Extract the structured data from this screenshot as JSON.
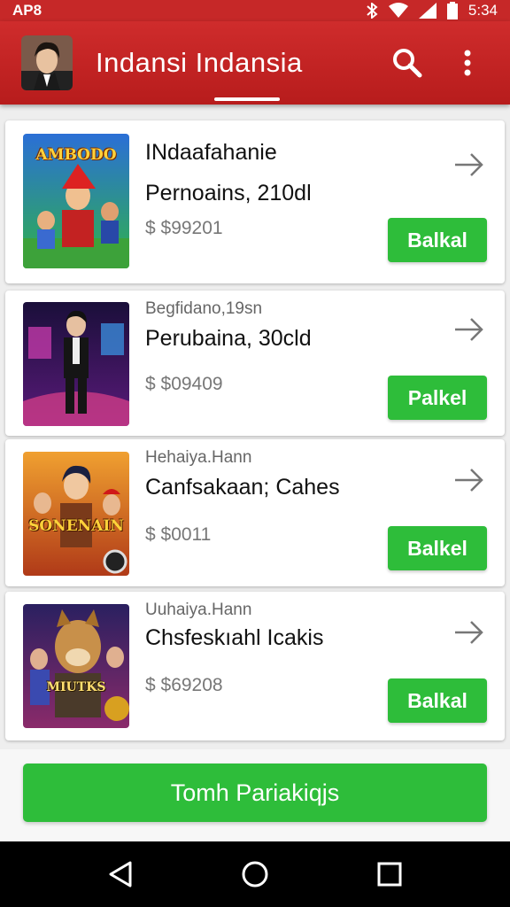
{
  "status_bar": {
    "left_text": "AP8",
    "time": "5:34"
  },
  "app_bar": {
    "title": "Indansi Indansia",
    "avatar_icon": "profile-avatar",
    "search_icon": "search-icon",
    "menu_icon": "more-vert-icon"
  },
  "items": [
    {
      "subtitle": "",
      "name_line1": "INdaafahanie",
      "name_line2": "Pernoains, 210dl",
      "price": "$ $99201",
      "button": "Balkal"
    },
    {
      "subtitle": "Begfidano,19sn",
      "name_line1": "",
      "name_line2": "Perubaina, 30cld",
      "price": "$ $09409",
      "button": "Palkel"
    },
    {
      "subtitle": "Hehaiya.Hann",
      "name_line1": "",
      "name_line2": "Canfsakaan; Cahes",
      "price": "$ $0011",
      "button": "Balkel"
    },
    {
      "subtitle": "Uuhaiya.Hann",
      "name_line1": "",
      "name_line2": "Chsfeskıahl Icakis",
      "price": "$ $69208",
      "button": "Balkal"
    }
  ],
  "thumbnails": [
    {
      "overlay_text": "AMBODO"
    },
    {
      "overlay_text": ""
    },
    {
      "overlay_text": "SONENAIN"
    },
    {
      "overlay_text": "MIUTKS"
    }
  ],
  "primary_button": "Tomh Pariakiqjs",
  "colors": {
    "app_bar": "#c62828",
    "accent_green": "#2ebd3a"
  }
}
